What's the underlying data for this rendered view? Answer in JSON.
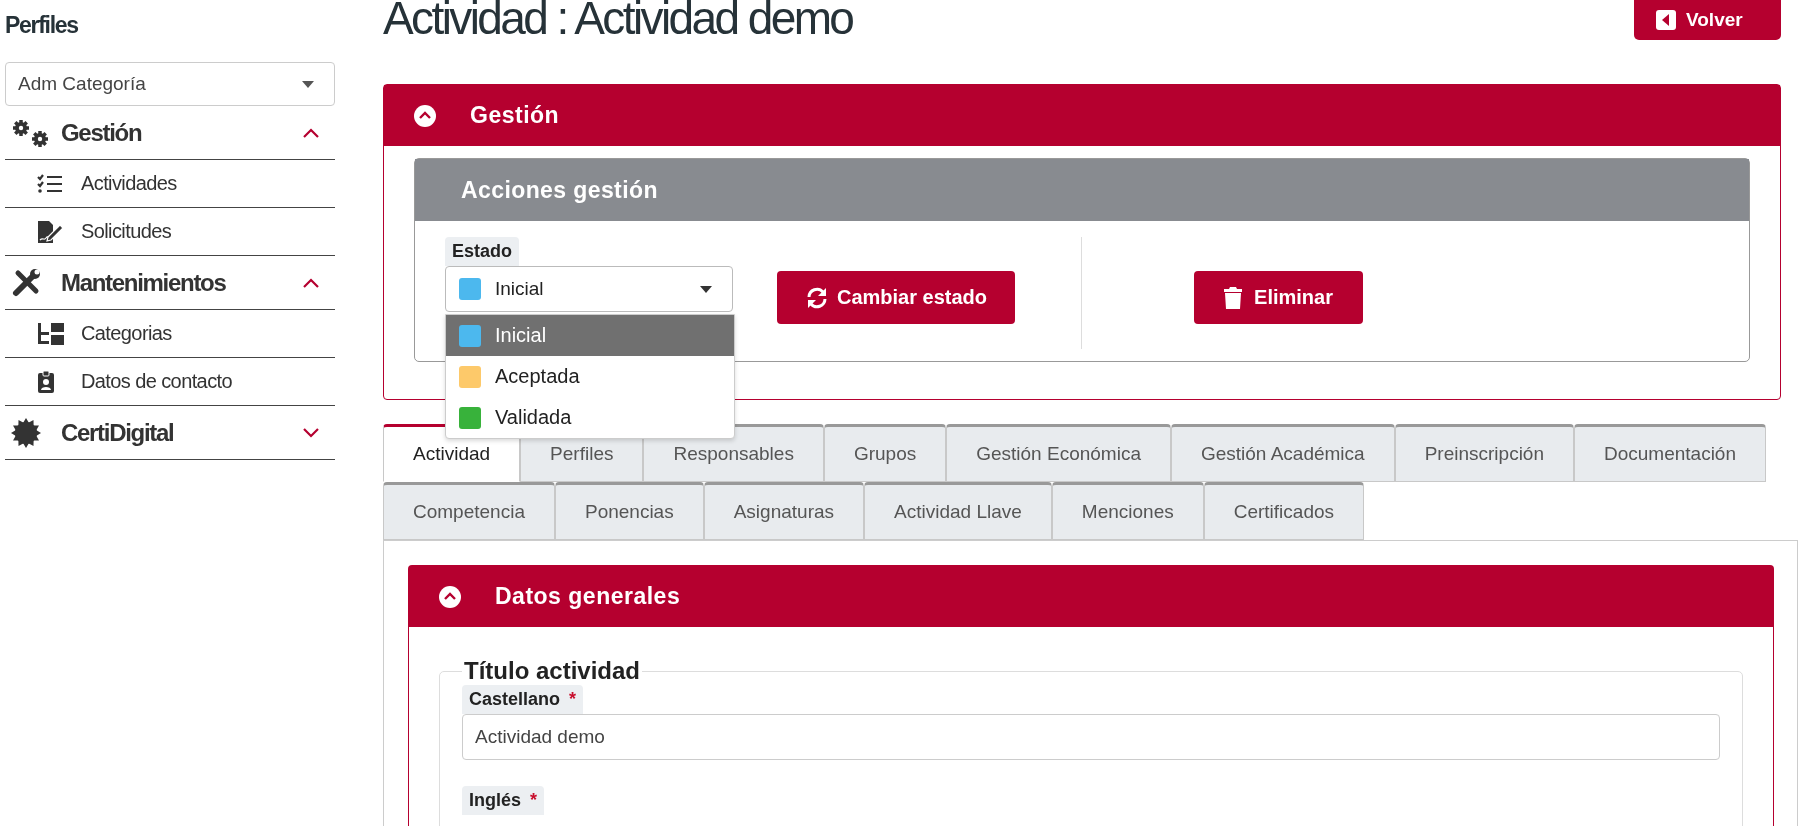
{
  "sidebar": {
    "title": "Perfiles",
    "profile_select": {
      "value": "Adm Categoría"
    },
    "sections": [
      {
        "label": "Gestión",
        "expanded": true,
        "items": [
          {
            "label": "Actividades"
          },
          {
            "label": "Solicitudes"
          }
        ]
      },
      {
        "label": "Mantenimientos",
        "expanded": true,
        "items": [
          {
            "label": "Categorias"
          },
          {
            "label": "Datos de contacto"
          }
        ]
      },
      {
        "label": "CertiDigital",
        "expanded": false
      }
    ]
  },
  "page": {
    "title": "Actividad : Actividad demo",
    "back_button": "Volver"
  },
  "gestion_panel": {
    "title": "Gestión",
    "expanded": true,
    "actions_card": {
      "title": "Acciones gestión",
      "estado": {
        "label": "Estado",
        "value": "Inicial",
        "open": true,
        "options": [
          {
            "label": "Inicial",
            "color": "#4cb8ee",
            "selected": true
          },
          {
            "label": "Aceptada",
            "color": "#fdc96a",
            "selected": false
          },
          {
            "label": "Validada",
            "color": "#38b23b",
            "selected": false
          }
        ]
      },
      "buttons": [
        {
          "label": "Cambiar estado"
        },
        {
          "label": "Eliminar"
        }
      ]
    }
  },
  "tab_rows": [
    {
      "tabs": [
        {
          "label": "Actividad",
          "selected": true
        },
        {
          "label": "Perfiles",
          "selected": false
        },
        {
          "label": "Responsables",
          "selected": false
        },
        {
          "label": "Grupos",
          "selected": false
        },
        {
          "label": "Gestión Económica",
          "selected": false
        },
        {
          "label": "Gestión Académica",
          "selected": false
        },
        {
          "label": "Preinscripción",
          "selected": false
        },
        {
          "label": "Documentación",
          "selected": false
        }
      ]
    },
    {
      "tabs": [
        {
          "label": "Competencia",
          "selected": false
        },
        {
          "label": "Ponencias",
          "selected": false
        },
        {
          "label": "Asignaturas",
          "selected": false
        },
        {
          "label": "Actividad Llave",
          "selected": false
        },
        {
          "label": "Menciones",
          "selected": false
        },
        {
          "label": "Certificados",
          "selected": false
        }
      ]
    }
  ],
  "datos_generales": {
    "title": "Datos generales",
    "expanded": true,
    "fieldset": {
      "legend": "Título actividad",
      "fields": [
        {
          "label": "Castellano",
          "required_mark": "*",
          "value": "Actividad demo"
        },
        {
          "label": "Inglés",
          "required_mark": "*"
        }
      ]
    }
  }
}
